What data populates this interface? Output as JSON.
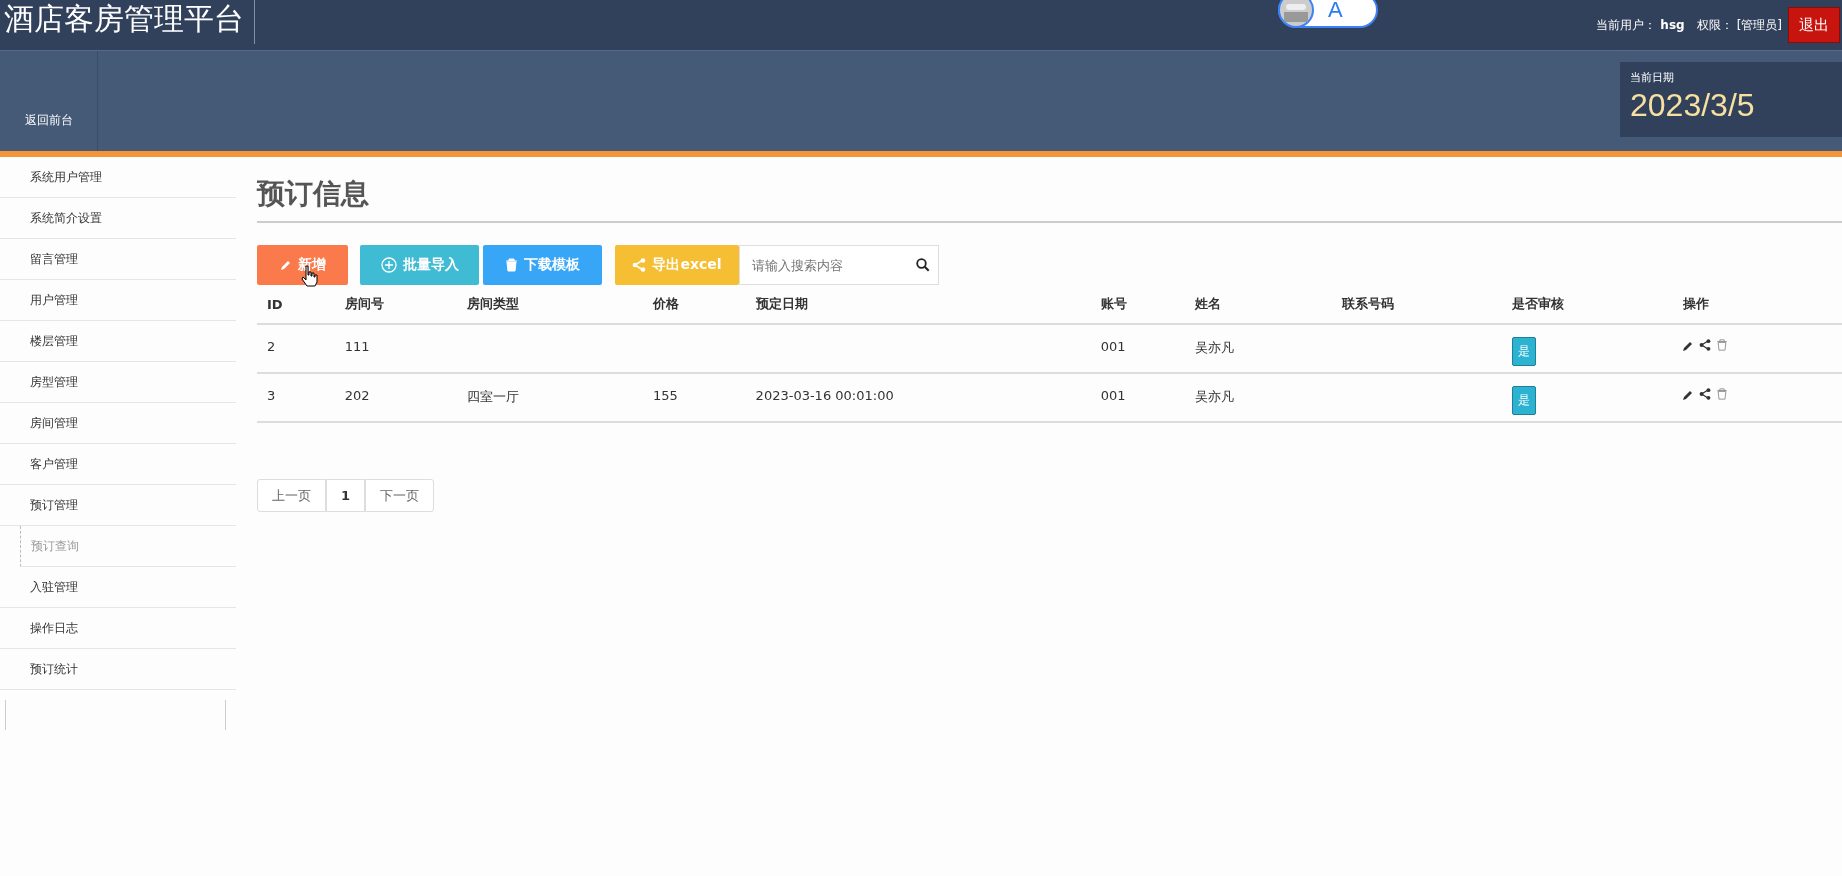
{
  "header": {
    "title": "酒店客房管理平台",
    "toggle_letter": "A",
    "user_label": "当前用户：",
    "user": "hsg",
    "role_label": "权限：",
    "role": "[管理员]",
    "logout": "退出"
  },
  "nav": {
    "items": [
      "返回前台"
    ],
    "date_label": "当前日期",
    "date": "2023/3/5"
  },
  "sidebar": {
    "items": [
      {
        "label": "系统用户管理",
        "selected": false
      },
      {
        "label": "系统简介设置",
        "selected": false
      },
      {
        "label": "留言管理",
        "selected": false
      },
      {
        "label": "用户管理",
        "selected": false
      },
      {
        "label": "楼层管理",
        "selected": false
      },
      {
        "label": "房型管理",
        "selected": false
      },
      {
        "label": "房间管理",
        "selected": false
      },
      {
        "label": "客户管理",
        "selected": false
      },
      {
        "label": "预订管理",
        "selected": false,
        "children": [
          {
            "label": "预订查询",
            "selected": true
          }
        ]
      },
      {
        "label": "入驻管理",
        "selected": false
      },
      {
        "label": "操作日志",
        "selected": false
      },
      {
        "label": "预订统计",
        "selected": false
      }
    ]
  },
  "page_title": "预订信息",
  "toolbar": {
    "buttons": [
      {
        "kind": "add",
        "label": "新增"
      },
      {
        "kind": "import",
        "label": "批量导入"
      },
      {
        "kind": "template",
        "label": "下载模板"
      },
      {
        "kind": "export",
        "label": "导出excel"
      }
    ],
    "search": {
      "placeholder": "请输入搜索内容"
    }
  },
  "table": {
    "columns": [
      "ID",
      "房间号",
      "房间类型",
      "价格",
      "预定日期",
      "账号",
      "姓名",
      "联系号码",
      "是否审核",
      "操作"
    ],
    "rows": [
      {
        "cells": [
          "2",
          "111",
          "",
          "",
          "",
          "001",
          "吴亦凡",
          ""
        ],
        "audit": "是"
      },
      {
        "cells": [
          "3",
          "202",
          "四室一厅",
          "155",
          "2023-03-16 00:01:00",
          "001",
          "吴亦凡",
          ""
        ],
        "audit": "是"
      }
    ]
  },
  "pagination": {
    "prev": "上一页",
    "pages": [
      {
        "label": "1",
        "selected": true
      }
    ],
    "next": "下一页"
  }
}
